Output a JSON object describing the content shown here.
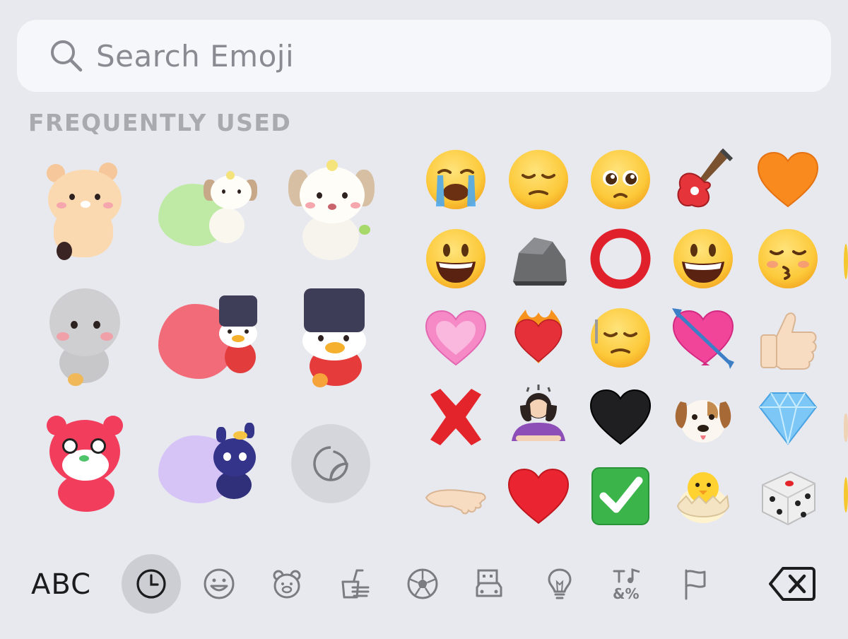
{
  "search": {
    "placeholder": "Search Emoji"
  },
  "section": {
    "label": "FREQUENTLY USED"
  },
  "stickers": [
    {
      "name": "sticker-bear-peach"
    },
    {
      "name": "sticker-puppy-green-cloud"
    },
    {
      "name": "sticker-puppy-white"
    },
    {
      "name": "sticker-gray-blob"
    },
    {
      "name": "sticker-penguin-pink-cloud"
    },
    {
      "name": "sticker-penguin-hat"
    },
    {
      "name": "sticker-pink-bear"
    },
    {
      "name": "sticker-blue-cat-lilac-cloud"
    }
  ],
  "emojis": [
    [
      "😭",
      "😔",
      "🥺",
      "🎸",
      "🧡"
    ],
    [
      "😃",
      "🪨",
      "⭕",
      "😀",
      "😚"
    ],
    [
      "💗",
      "❤️‍🔥",
      "😔",
      "💘",
      "👍🏻"
    ],
    [
      "❌",
      "🙇🏻‍♀️",
      "🖤",
      "🐶",
      "💎"
    ],
    [
      "🫳🏻",
      "❤️",
      "✅",
      "🐣",
      "🎲"
    ]
  ],
  "bottom_bar": {
    "abc_label": "ABC",
    "categories": [
      "recents-icon",
      "smileys-icon",
      "animals-icon",
      "food-icon",
      "activity-icon",
      "travel-icon",
      "objects-icon",
      "symbols-icon",
      "flags-icon"
    ],
    "active": "recents-icon"
  }
}
